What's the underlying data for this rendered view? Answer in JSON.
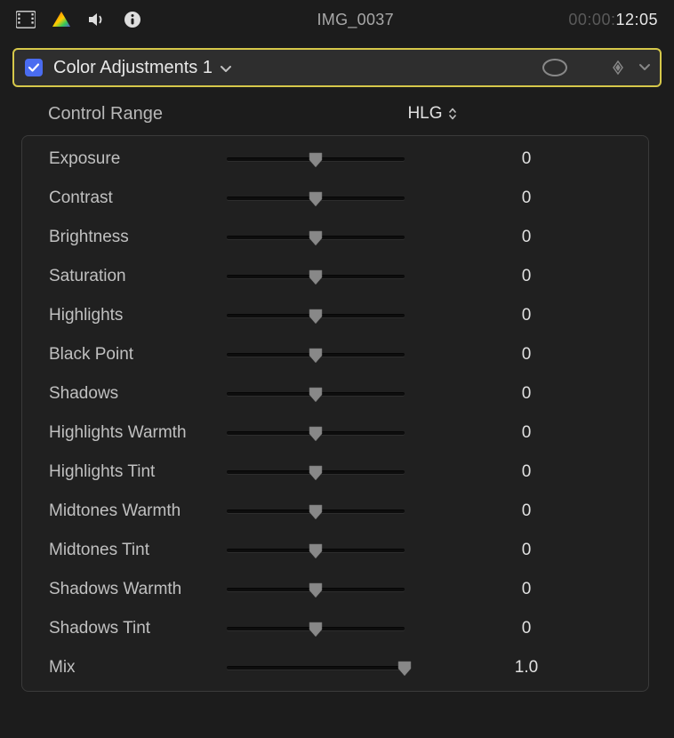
{
  "header": {
    "clip_name": "IMG_0037",
    "timecode_dim": "00:00:",
    "timecode_bright": "12:05"
  },
  "effect": {
    "title": "Color Adjustments 1"
  },
  "control_range": {
    "label": "Control Range",
    "value": "HLG"
  },
  "params": [
    {
      "label": "Exposure",
      "value": "0",
      "thumb_pct": 50
    },
    {
      "label": "Contrast",
      "value": "0",
      "thumb_pct": 50
    },
    {
      "label": "Brightness",
      "value": "0",
      "thumb_pct": 50
    },
    {
      "label": "Saturation",
      "value": "0",
      "thumb_pct": 50
    },
    {
      "label": "Highlights",
      "value": "0",
      "thumb_pct": 50
    },
    {
      "label": "Black Point",
      "value": "0",
      "thumb_pct": 50
    },
    {
      "label": "Shadows",
      "value": "0",
      "thumb_pct": 50
    },
    {
      "label": "Highlights Warmth",
      "value": "0",
      "thumb_pct": 50
    },
    {
      "label": "Highlights Tint",
      "value": "0",
      "thumb_pct": 50
    },
    {
      "label": "Midtones Warmth",
      "value": "0",
      "thumb_pct": 50
    },
    {
      "label": "Midtones Tint",
      "value": "0",
      "thumb_pct": 50
    },
    {
      "label": "Shadows Warmth",
      "value": "0",
      "thumb_pct": 50
    },
    {
      "label": "Shadows Tint",
      "value": "0",
      "thumb_pct": 50
    },
    {
      "label": "Mix",
      "value": "1.0",
      "thumb_pct": 100
    }
  ]
}
